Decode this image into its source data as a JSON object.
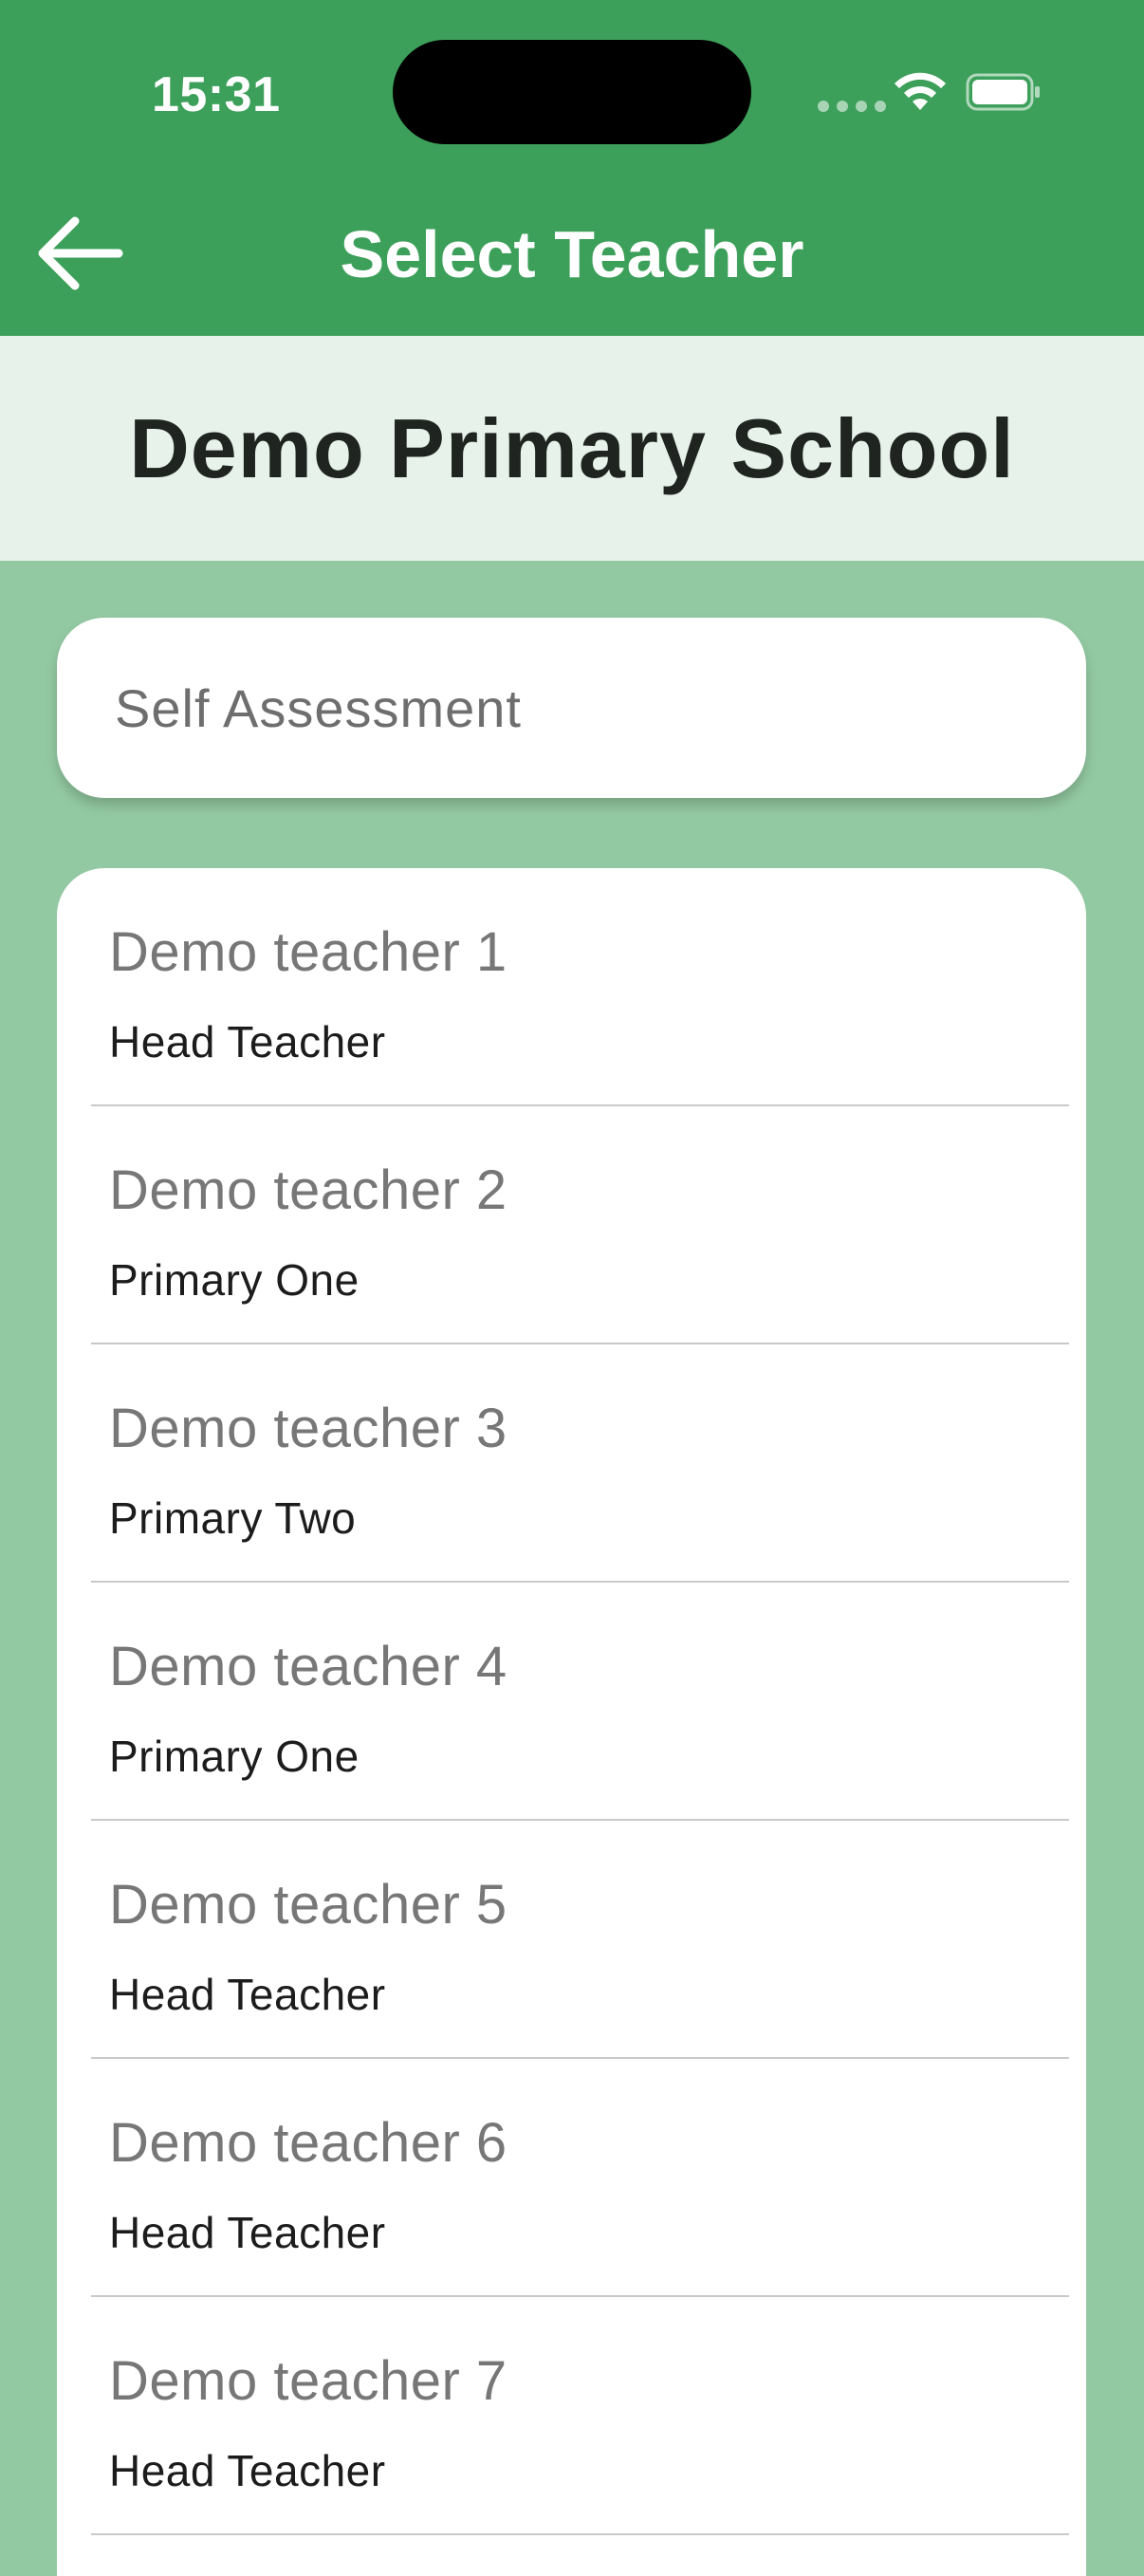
{
  "status_bar": {
    "time": "15:31"
  },
  "header": {
    "title": "Select Teacher",
    "back_icon": "arrow-left-icon"
  },
  "school": {
    "name": "Demo Primary School"
  },
  "self_assessment": {
    "label": "Self Assessment"
  },
  "teachers": [
    {
      "name": "Demo teacher 1",
      "role": "Head Teacher"
    },
    {
      "name": "Demo teacher 2",
      "role": "Primary One"
    },
    {
      "name": "Demo teacher 3",
      "role": "Primary Two"
    },
    {
      "name": "Demo teacher 4",
      "role": "Primary One"
    },
    {
      "name": "Demo teacher 5",
      "role": "Head Teacher"
    },
    {
      "name": "Demo teacher 6",
      "role": "Head Teacher"
    },
    {
      "name": "Demo teacher 7",
      "role": "Head Teacher"
    }
  ],
  "colors": {
    "header_green": "#3da05a",
    "background_green": "#93c9a2",
    "school_band": "#e7f2eb"
  }
}
